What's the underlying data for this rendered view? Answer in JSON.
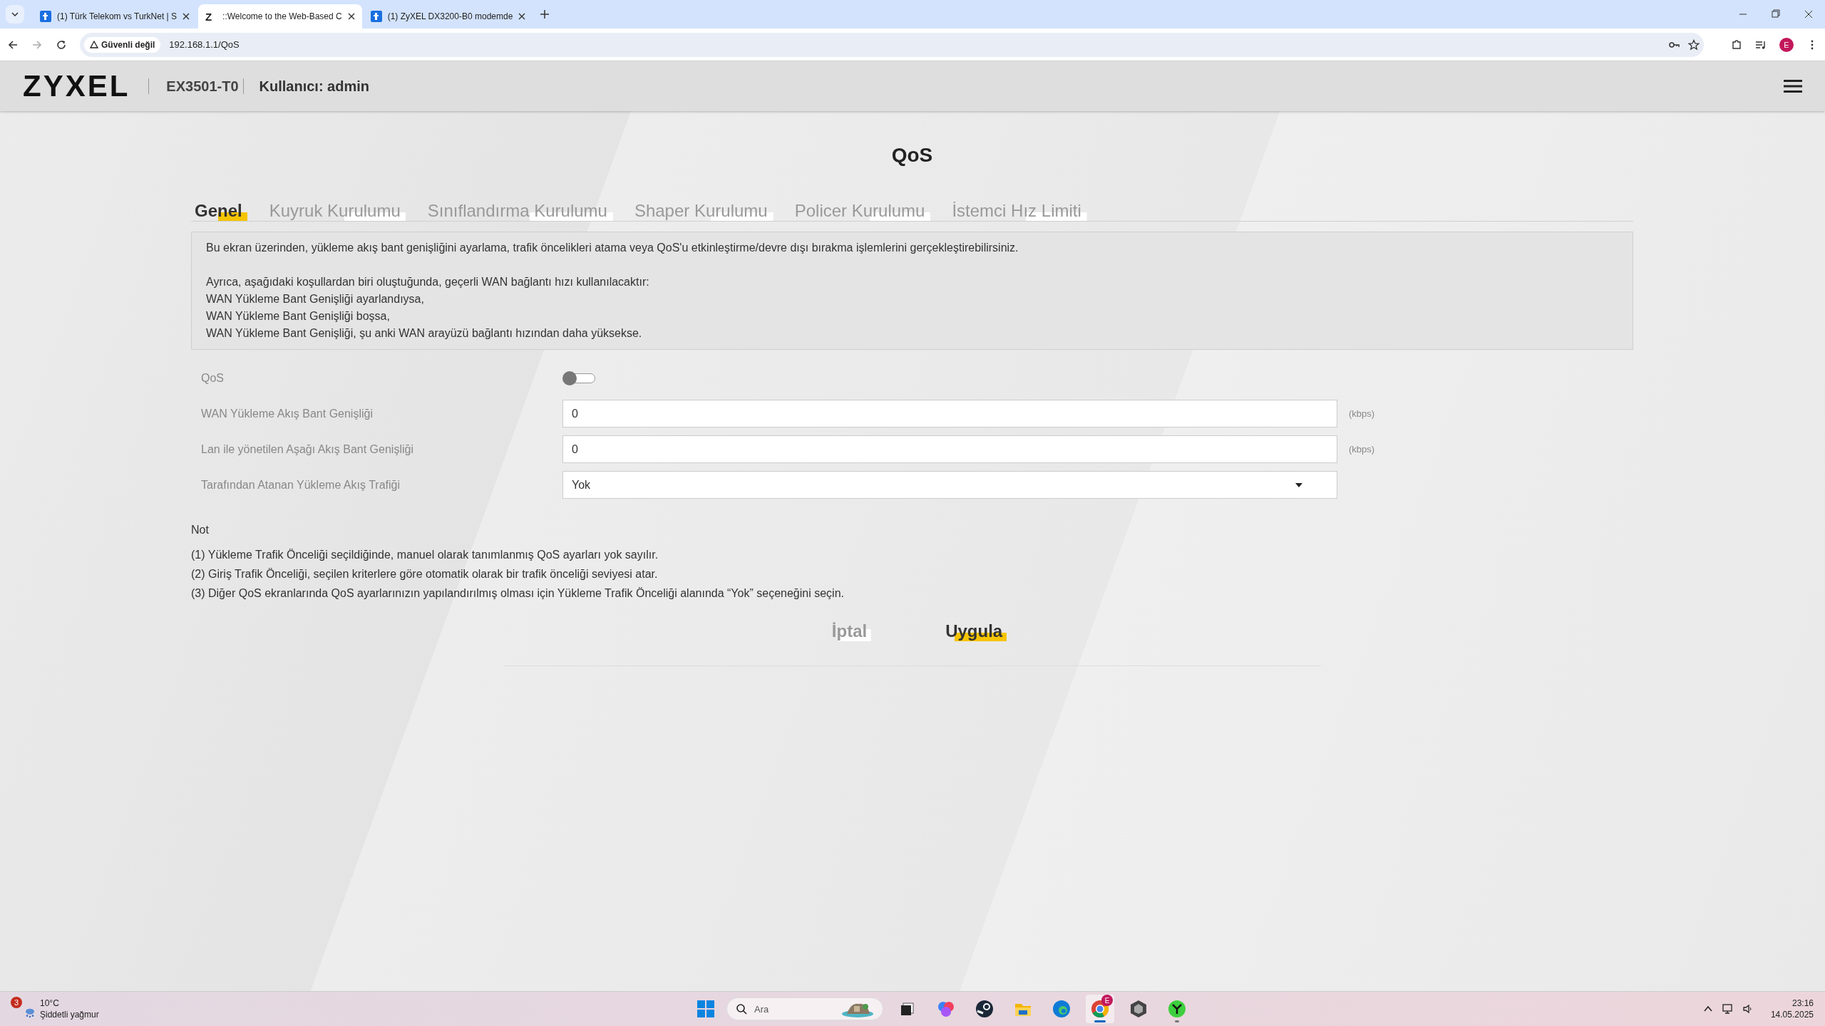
{
  "browser": {
    "tabs": [
      {
        "title": "(1) Türk Telekom vs TurkNet | S",
        "selected": false,
        "favicon": {
          "kind": "square"
        }
      },
      {
        "title": "::Welcome to the Web-Based C",
        "selected": true,
        "favicon": {
          "kind": "letter",
          "text": "Z"
        }
      },
      {
        "title": "(1) ZyXEL DX3200-B0 modemde",
        "selected": false,
        "favicon": {
          "kind": "square"
        }
      }
    ],
    "security": "Güvenli değil",
    "url": "192.168.1.1/QoS",
    "profile": "E"
  },
  "header": {
    "logo": "ZYXEL",
    "model": "EX3501-T0",
    "user": "Kullanıcı: admin"
  },
  "page_title": "QoS",
  "tabs": [
    {
      "label": "Genel",
      "selected": true
    },
    {
      "label": "Kuyruk Kurulumu",
      "selected": false
    },
    {
      "label": "Sınıflandırma Kurulumu",
      "selected": false
    },
    {
      "label": "Shaper Kurulumu",
      "selected": false
    },
    {
      "label": "Policer Kurulumu",
      "selected": false
    },
    {
      "label": "İstemci Hız Limiti",
      "selected": false
    }
  ],
  "info": {
    "intro": "Bu ekran üzerinden, yükleme akış bant genişliğini ayarlama, trafik öncelikleri atama veya QoS'u etkinleştirme/devre dışı bırakma işlemlerini gerçekleştirebilirsiniz.",
    "conditions": [
      "Ayrıca, aşağıdaki koşullardan biri oluştuğunda, geçerli WAN bağlantı hızı kullanılacaktır:",
      "WAN Yükleme Bant Genişliği ayarlandıysa,",
      "WAN Yükleme Bant Genişliği boşsa,",
      "WAN Yükleme Bant Genişliği, şu anki WAN arayüzü bağlantı hızından daha yüksekse."
    ]
  },
  "form": [
    {
      "kind": "toggle",
      "label": "QoS",
      "on": false
    },
    {
      "kind": "input",
      "label": "WAN Yükleme Akış Bant Genişliği",
      "value": "0",
      "unit": "(kbps)"
    },
    {
      "kind": "input",
      "label": "Lan ile yönetilen Aşağı Akış Bant Genişliği",
      "value": "0",
      "unit": "(kbps)"
    },
    {
      "kind": "select",
      "label": "Tarafından Atanan Yükleme Akış Trafiği",
      "value": "Yok"
    }
  ],
  "notes": {
    "title": "Not",
    "items": [
      "(1) Yükleme Trafik Önceliği seçildiğinde, manuel olarak tanımlanmış QoS ayarları yok sayılır.",
      "(2) Giriş Trafik Önceliği, seçilen kriterlere göre otomatik olarak bir trafik önceliği seviyesi atar.",
      "(3) Diğer QoS ekranlarında QoS ayarlarınızın yapılandırılmış olması için Yükleme Trafik Önceliği alanında “Yok” seçeneğini seçin."
    ]
  },
  "buttons": [
    {
      "label": "İptal",
      "kind": "secondary"
    },
    {
      "label": "Uygula",
      "kind": "primary"
    }
  ],
  "taskbar": {
    "weather": {
      "badge": "3",
      "temp": "10°C",
      "desc": "Şiddetli yağmur"
    },
    "search_placeholder": "Ara",
    "apps": [
      {
        "kind": "taskview",
        "active": false,
        "open": false
      },
      {
        "kind": "copilot",
        "active": false,
        "open": false
      },
      {
        "kind": "steam",
        "active": false,
        "open": false
      },
      {
        "kind": "folder",
        "active": false,
        "open": false
      },
      {
        "kind": "edge",
        "active": false,
        "open": false
      },
      {
        "kind": "chrome",
        "active": true,
        "open": true,
        "badge": "E"
      },
      {
        "kind": "cube",
        "active": false,
        "open": false
      },
      {
        "kind": "green",
        "active": false,
        "open": true
      }
    ],
    "time": "23:16",
    "date": "14.05.2025"
  }
}
